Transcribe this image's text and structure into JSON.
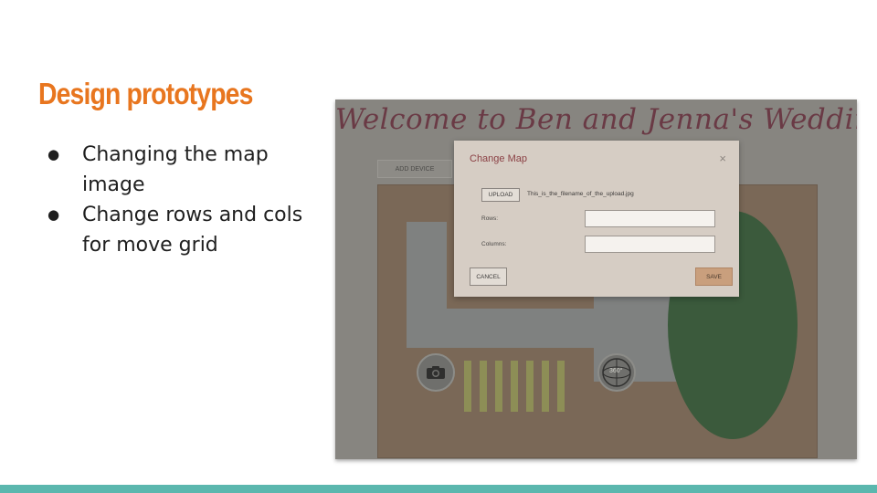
{
  "slide": {
    "title": "Design prototypes",
    "bullets": [
      "Changing the map image",
      "Change rows and cols for move grid"
    ]
  },
  "mockup": {
    "heading": "Welcome to Ben and Jenna's Wedding",
    "add_device_label": "ADD DEVICE",
    "icon_360_label": "360°",
    "dialog": {
      "title": "Change Map",
      "close_glyph": "×",
      "upload_label": "UPLOAD",
      "upload_filename": "This_is_the_filename_of_the_upload.jpg",
      "rows_label": "Rows:",
      "rows_value": "",
      "columns_label": "Columns:",
      "columns_value": "",
      "cancel_label": "CANCEL",
      "save_label": "SAVE"
    }
  },
  "colors": {
    "title_accent": "#e8761f",
    "footer_bar": "#5bb7ae",
    "dialog_title": "#8a3f43",
    "save_button": "#c99f7d"
  }
}
